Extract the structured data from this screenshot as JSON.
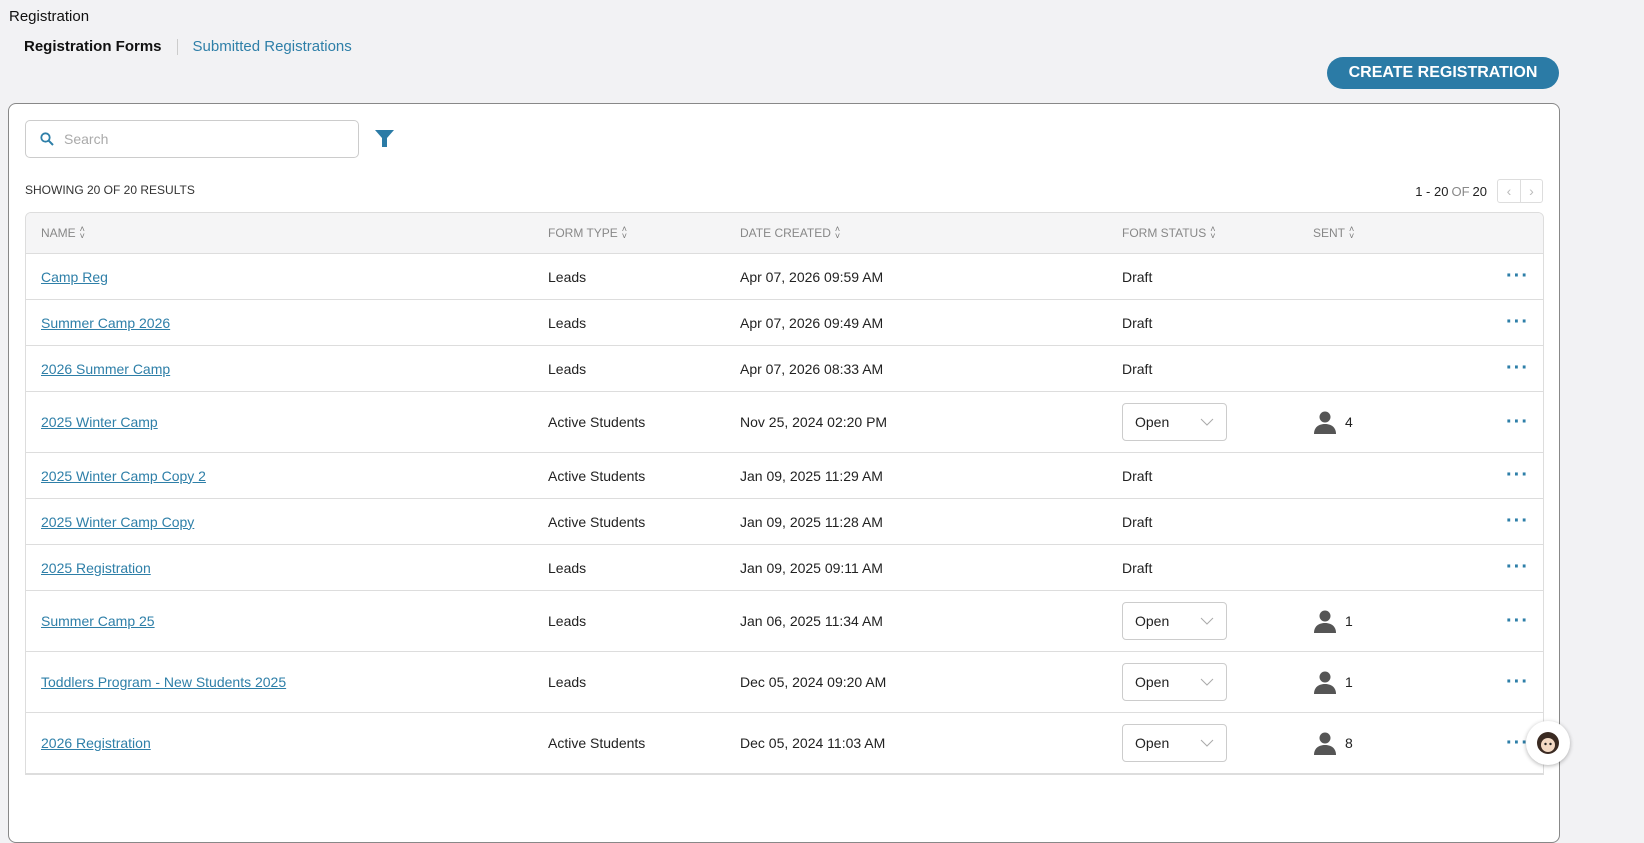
{
  "header": {
    "title": "Registration",
    "tabs": [
      {
        "label": "Registration Forms"
      },
      {
        "label": "Submitted Registrations"
      }
    ],
    "create_label": "CREATE REGISTRATION"
  },
  "toolbar": {
    "search_placeholder": "Search",
    "search_value": ""
  },
  "results": {
    "showing": "SHOWING 20 OF 20 RESULTS",
    "range": "1 - 20",
    "of": "OF",
    "total": "20"
  },
  "columns": [
    "NAME",
    "FORM TYPE",
    "DATE CREATED",
    "FORM STATUS",
    "SENT"
  ],
  "rows": [
    {
      "name": "Camp Reg",
      "type": "Leads",
      "date": "Apr 07, 2026 09:59 AM",
      "status": "Draft",
      "sent": ""
    },
    {
      "name": "Summer Camp 2026",
      "type": "Leads",
      "date": "Apr 07, 2026 09:49 AM",
      "status": "Draft",
      "sent": ""
    },
    {
      "name": "2026 Summer Camp",
      "type": "Leads",
      "date": "Apr 07, 2026 08:33 AM",
      "status": "Draft",
      "sent": ""
    },
    {
      "name": "2025 Winter Camp",
      "type": "Active Students",
      "date": "Nov 25, 2024 02:20 PM",
      "status": "Open",
      "sent": "4"
    },
    {
      "name": "2025 Winter Camp Copy 2",
      "type": "Active Students",
      "date": "Jan 09, 2025 11:29 AM",
      "status": "Draft",
      "sent": ""
    },
    {
      "name": "2025 Winter Camp Copy",
      "type": "Active Students",
      "date": "Jan 09, 2025 11:28 AM",
      "status": "Draft",
      "sent": ""
    },
    {
      "name": "2025 Registration",
      "type": "Leads",
      "date": "Jan 09, 2025 09:11 AM",
      "status": "Draft",
      "sent": ""
    },
    {
      "name": "Summer Camp 25",
      "type": "Leads",
      "date": "Jan 06, 2025 11:34 AM",
      "status": "Open",
      "sent": "1"
    },
    {
      "name": "Toddlers Program - New Students 2025",
      "type": "Leads",
      "date": "Dec 05, 2024 09:20 AM",
      "status": "Open",
      "sent": "1"
    },
    {
      "name": "2026 Registration",
      "type": "Active Students",
      "date": "Dec 05, 2024 11:03 AM",
      "status": "Open",
      "sent": "8"
    }
  ],
  "colors": {
    "accent": "#2b7ba6",
    "link": "#2e7fa8"
  }
}
